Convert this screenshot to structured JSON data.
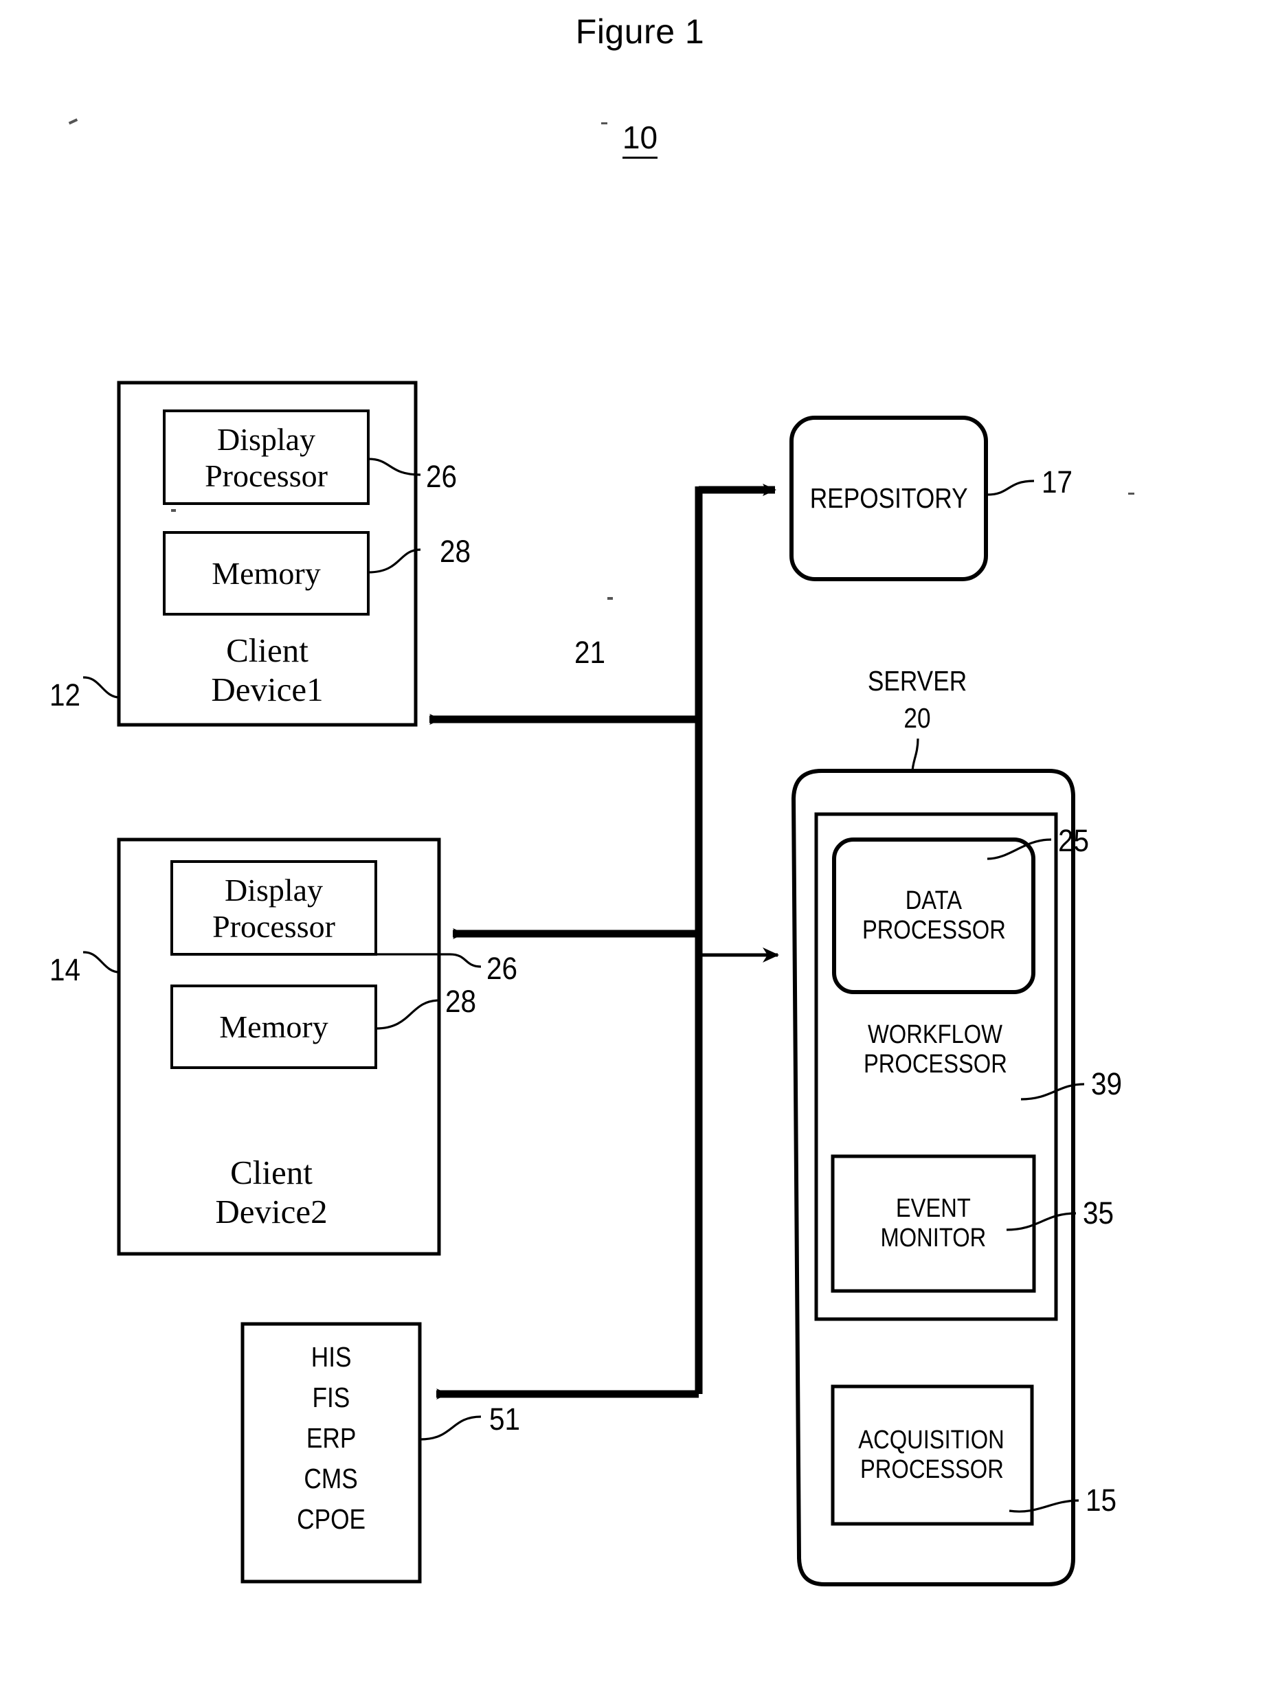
{
  "figure": {
    "title": "Figure 1",
    "system_ref": "10"
  },
  "client_device_1": {
    "ref": "12",
    "label_line1": "Client",
    "label_line2": "Device1",
    "display_processor": {
      "line1": "Display",
      "line2": "Processor",
      "ref": "26"
    },
    "memory": {
      "label": "Memory",
      "ref": "28"
    }
  },
  "client_device_2": {
    "ref": "14",
    "label_line1": "Client",
    "label_line2": "Device2",
    "display_processor": {
      "line1": "Display",
      "line2": "Processor",
      "ref": "26"
    },
    "memory": {
      "label": "Memory",
      "ref": "28"
    }
  },
  "repository": {
    "label": "REPOSITORY",
    "ref": "17"
  },
  "server": {
    "title": "SERVER",
    "ref": "20",
    "data_processor": {
      "line1": "DATA",
      "line2": "PROCESSOR",
      "ref": "25"
    },
    "workflow_processor": {
      "line1": "WORKFLOW",
      "line2": "PROCESSOR",
      "ref": "39"
    },
    "event_monitor": {
      "line1": "EVENT",
      "line2": "MONITOR",
      "ref": "35"
    },
    "acquisition_processor": {
      "line1": "ACQUISITION",
      "line2": "PROCESSOR",
      "ref": "15"
    }
  },
  "information_systems": {
    "ref": "51",
    "items": [
      "HIS",
      "FIS",
      "ERP",
      "CMS",
      "CPOE"
    ]
  },
  "network": {
    "ref": "21"
  },
  "colors": {
    "ink": "#000000",
    "paper": "#ffffff"
  }
}
